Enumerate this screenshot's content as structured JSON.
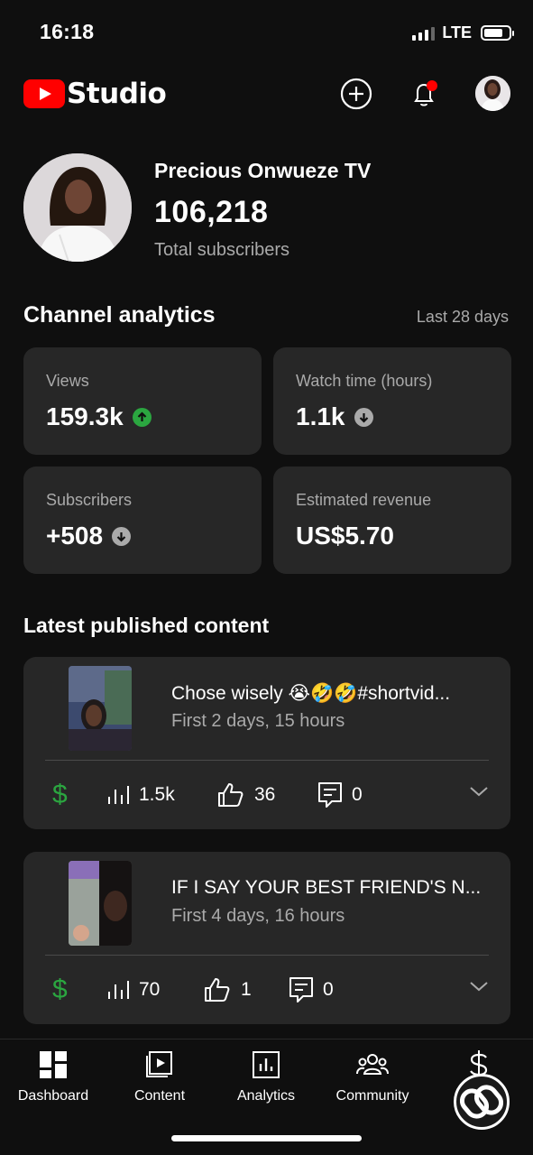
{
  "status_bar": {
    "time": "16:18",
    "network": "LTE",
    "battery_level": 0.75
  },
  "header": {
    "brand": "Studio",
    "icons": [
      "create-icon",
      "notifications-icon",
      "profile-avatar"
    ]
  },
  "channel": {
    "name": "Precious Onwueze TV",
    "subscribers": "106,218",
    "subscribers_label": "Total subscribers"
  },
  "analytics": {
    "title": "Channel analytics",
    "period": "Last 28 days",
    "cards": [
      {
        "label": "Views",
        "value": "159.3k",
        "trend": "up"
      },
      {
        "label": "Watch time (hours)",
        "value": "1.1k",
        "trend": "down"
      },
      {
        "label": "Subscribers",
        "value": "+508",
        "trend": "down"
      },
      {
        "label": "Estimated revenue",
        "value": "US$5.70",
        "trend": "none"
      }
    ]
  },
  "latest": {
    "title": "Latest published content",
    "items": [
      {
        "title": "Chose wisely 😭🤣🤣#shortvid...",
        "subtitle": "First 2 days, 15 hours",
        "views": "1.5k",
        "likes": "36",
        "comments": "0"
      },
      {
        "title": "IF I SAY YOUR BEST FRIEND'S N...",
        "subtitle": "First 4 days, 16 hours",
        "views": "70",
        "likes": "1",
        "comments": "0"
      }
    ]
  },
  "bottom_nav": {
    "items": [
      {
        "label": "Dashboard",
        "icon": "dashboard-icon"
      },
      {
        "label": "Content",
        "icon": "content-icon"
      },
      {
        "label": "Analytics",
        "icon": "analytics-icon"
      },
      {
        "label": "Community",
        "icon": "community-icon"
      },
      {
        "label": "Earn",
        "icon": "earn-icon"
      }
    ]
  },
  "colors": {
    "background": "#0f0f0f",
    "card": "#272727",
    "accent_red": "#ff0000",
    "positive_green": "#2ba640",
    "muted_text": "#aaaaaa"
  }
}
